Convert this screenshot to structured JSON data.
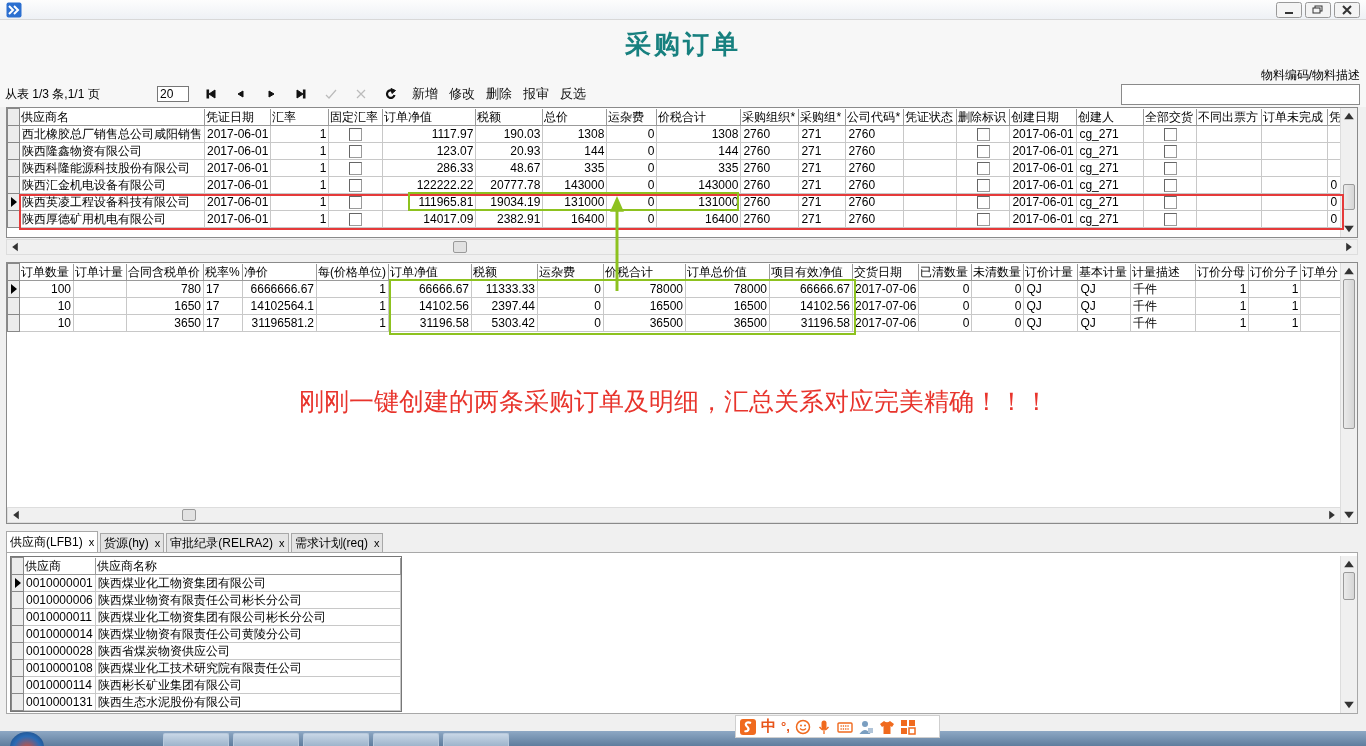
{
  "window": {
    "title": "采购订单"
  },
  "filter_label": "物料编码/物料描述",
  "toolbar": {
    "page_info": "从表 1/3 条,1/1 页",
    "page_size": "20",
    "nav": [
      {
        "kind": "first",
        "disabled": false
      },
      {
        "kind": "prev",
        "disabled": false
      },
      {
        "kind": "next",
        "disabled": false
      },
      {
        "kind": "last",
        "disabled": false
      },
      {
        "kind": "confirm",
        "disabled": true
      },
      {
        "kind": "cancel",
        "disabled": true
      },
      {
        "kind": "refresh",
        "disabled": false
      }
    ],
    "buttons": [
      "新增",
      "修改",
      "删除",
      "报审",
      "反选"
    ]
  },
  "header_grid": {
    "columns": [
      {
        "label": "供应商名",
        "kind": "text"
      },
      {
        "label": "凭证日期",
        "kind": "text"
      },
      {
        "label": "汇率",
        "kind": "number"
      },
      {
        "label": "固定汇率",
        "kind": "check"
      },
      {
        "label": "订单净值",
        "kind": "number"
      },
      {
        "label": "税额",
        "kind": "number"
      },
      {
        "label": "总价",
        "kind": "number"
      },
      {
        "label": "运杂费",
        "kind": "number"
      },
      {
        "label": "价税合计",
        "kind": "number"
      },
      {
        "label": "采购组织*",
        "kind": "text"
      },
      {
        "label": "采购组*",
        "kind": "text"
      },
      {
        "label": "公司代码*",
        "kind": "text"
      },
      {
        "label": "凭证状态",
        "kind": "text"
      },
      {
        "label": "删除标识",
        "kind": "check"
      },
      {
        "label": "创建日期",
        "kind": "text"
      },
      {
        "label": "创建人",
        "kind": "text"
      },
      {
        "label": "全部交货",
        "kind": "check"
      },
      {
        "label": "不同出票方",
        "kind": "text"
      },
      {
        "label": "订单未完成",
        "kind": "text"
      },
      {
        "label": "凭",
        "kind": "text"
      }
    ],
    "rows": [
      {
        "selected": false,
        "cells": [
          "西北橡胶总厂销售总公司咸阳销售",
          "2017-06-01",
          "1",
          false,
          "1117.97",
          "190.03",
          "1308",
          "0",
          "1308",
          "2760",
          "271",
          "2760",
          null,
          false,
          "2017-06-01",
          "cg_271",
          false,
          null,
          null,
          null
        ]
      },
      {
        "selected": false,
        "cells": [
          "陕西隆鑫物资有限公司",
          "2017-06-01",
          "1",
          false,
          "123.07",
          "20.93",
          "144",
          "0",
          "144",
          "2760",
          "271",
          "2760",
          null,
          false,
          "2017-06-01",
          "cg_271",
          false,
          null,
          null,
          null
        ]
      },
      {
        "selected": false,
        "cells": [
          "陕西科隆能源科技股份有限公司",
          "2017-06-01",
          "1",
          false,
          "286.33",
          "48.67",
          "335",
          "0",
          "335",
          "2760",
          "271",
          "2760",
          null,
          false,
          "2017-06-01",
          "cg_271",
          false,
          null,
          null,
          null
        ]
      },
      {
        "selected": false,
        "cells": [
          "陕西汇金机电设备有限公司",
          "2017-06-01",
          "1",
          false,
          "122222.22",
          "20777.78",
          "143000",
          "0",
          "143000",
          "2760",
          "271",
          "2760",
          null,
          false,
          "2017-06-01",
          "cg_271",
          false,
          null,
          null,
          "0"
        ]
      },
      {
        "selected": true,
        "cells": [
          "陕西英凌工程设备科技有限公司",
          "2017-06-01",
          "1",
          false,
          "111965.81",
          "19034.19",
          "131000",
          "0",
          "131000",
          "2760",
          "271",
          "2760",
          null,
          false,
          "2017-06-01",
          "cg_271",
          false,
          null,
          null,
          "0"
        ]
      },
      {
        "selected": false,
        "cells": [
          "陕西厚德矿用机电有限公司",
          "2017-06-01",
          "1",
          false,
          "14017.09",
          "2382.91",
          "16400",
          "0",
          "16400",
          "2760",
          "271",
          "2760",
          null,
          false,
          "2017-06-01",
          "cg_271",
          false,
          null,
          null,
          "0"
        ]
      }
    ]
  },
  "detail_grid": {
    "columns": [
      {
        "label": "订单数量",
        "kind": "number"
      },
      {
        "label": "订单计量",
        "kind": "text"
      },
      {
        "label": "合同含税单价",
        "kind": "number"
      },
      {
        "label": "税率%",
        "kind": "text"
      },
      {
        "label": "净价",
        "kind": "number"
      },
      {
        "label": "每(价格单位)",
        "kind": "number"
      },
      {
        "label": "订单净值",
        "kind": "number"
      },
      {
        "label": "税额",
        "kind": "number"
      },
      {
        "label": "运杂费",
        "kind": "number"
      },
      {
        "label": "价税合计",
        "kind": "number"
      },
      {
        "label": "订单总价值",
        "kind": "number"
      },
      {
        "label": "项目有效净值",
        "kind": "number"
      },
      {
        "label": "交货日期",
        "kind": "text"
      },
      {
        "label": "已清数量",
        "kind": "number"
      },
      {
        "label": "未清数量",
        "kind": "number"
      },
      {
        "label": "订价计量",
        "kind": "text"
      },
      {
        "label": "基本计量",
        "kind": "text"
      },
      {
        "label": "计量描述",
        "kind": "text"
      },
      {
        "label": "订价分母",
        "kind": "number"
      },
      {
        "label": "订价分子",
        "kind": "number"
      },
      {
        "label": "订单分",
        "kind": "text"
      }
    ],
    "rows": [
      {
        "selected": true,
        "cells": [
          "100",
          null,
          "780",
          "17",
          "6666666.67",
          "1",
          "66666.67",
          "11333.33",
          "0",
          "78000",
          "78000",
          "66666.67",
          "2017-07-06",
          "0",
          "0",
          "QJ",
          "QJ",
          "千件",
          "1",
          "1",
          null
        ]
      },
      {
        "selected": false,
        "cells": [
          "10",
          null,
          "1650",
          "17",
          "14102564.1",
          "1",
          "14102.56",
          "2397.44",
          "0",
          "16500",
          "16500",
          "14102.56",
          "2017-07-06",
          "0",
          "0",
          "QJ",
          "QJ",
          "千件",
          "1",
          "1",
          null
        ]
      },
      {
        "selected": false,
        "cells": [
          "10",
          null,
          "3650",
          "17",
          "31196581.2",
          "1",
          "31196.58",
          "5303.42",
          "0",
          "36500",
          "36500",
          "31196.58",
          "2017-07-06",
          "0",
          "0",
          "QJ",
          "QJ",
          "千件",
          "1",
          "1",
          null
        ]
      }
    ]
  },
  "annotation": "刚刚一键创建的两条采购订单及明细，汇总关系对应完美精确！！！",
  "tabs": [
    {
      "label": "供应商(LFB1)",
      "close": "x",
      "selected": true
    },
    {
      "label": "货源(hy)",
      "close": "x",
      "selected": false
    },
    {
      "label": "审批纪录(RELRA2)",
      "close": "x",
      "selected": false
    },
    {
      "label": "需求计划(req)",
      "close": "x",
      "selected": false
    }
  ],
  "supplier_grid": {
    "columns": [
      {
        "label": "供应商"
      },
      {
        "label": "供应商名称"
      }
    ],
    "rows": [
      {
        "selected": true,
        "cells": [
          "0010000001",
          "陕西煤业化工物资集团有限公司"
        ]
      },
      {
        "selected": false,
        "cells": [
          "0010000006",
          "陕西煤业物资有限责任公司彬长分公司"
        ]
      },
      {
        "selected": false,
        "cells": [
          "0010000011",
          "陕西煤业化工物资集团有限公司彬长分公司"
        ]
      },
      {
        "selected": false,
        "cells": [
          "0010000014",
          "陕西煤业物资有限责任公司黄陵分公司"
        ]
      },
      {
        "selected": false,
        "cells": [
          "0010000028",
          "陕西省煤炭物资供应公司"
        ]
      },
      {
        "selected": false,
        "cells": [
          "0010000108",
          "陕西煤业化工技术研究院有限责任公司"
        ]
      },
      {
        "selected": false,
        "cells": [
          "0010000114",
          "陕西彬长矿业集团有限公司"
        ]
      },
      {
        "selected": false,
        "cells": [
          "0010000131",
          "陕西生态水泥股份有限公司"
        ]
      }
    ]
  },
  "ime": {
    "mode": "中",
    "punctuation": "°,"
  }
}
